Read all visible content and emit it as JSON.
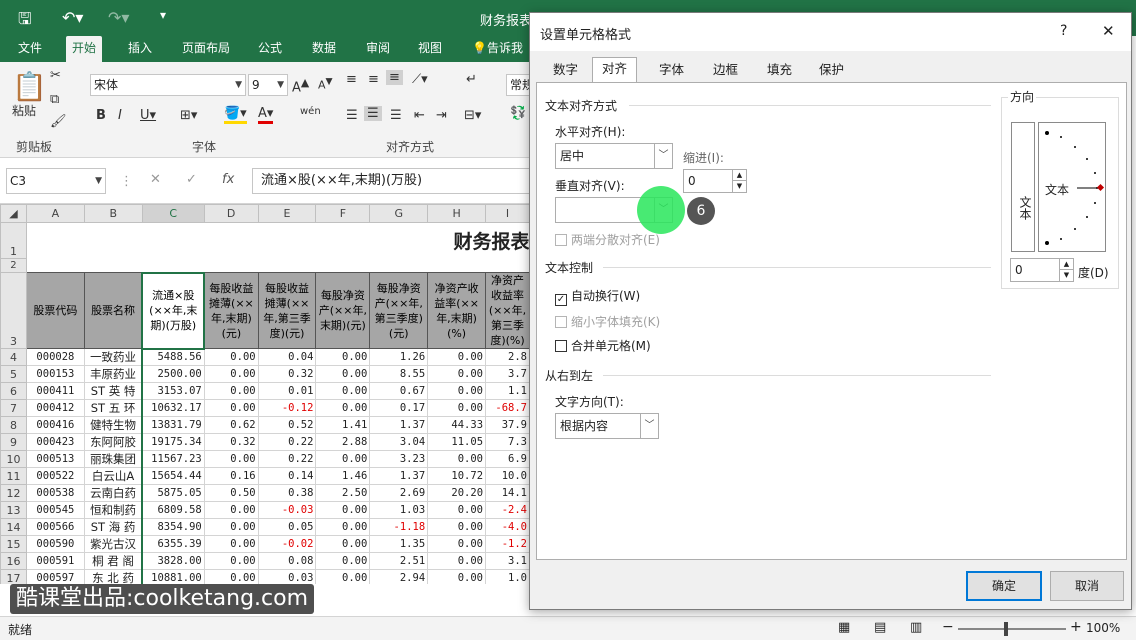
{
  "titlebar": {
    "title": "财务报表"
  },
  "ribbon": {
    "tabs": [
      "文件",
      "开始",
      "插入",
      "页面布局",
      "公式",
      "数据",
      "审阅",
      "视图",
      "告诉我你"
    ],
    "active_tab": "开始",
    "paste_label": "粘贴",
    "clipboard_label": "剪贴板",
    "font_group_label": "字体",
    "align_group_label": "对齐方式",
    "font_name": "宋体",
    "font_size": "9",
    "number_format": "常规",
    "wrap_label": "wén"
  },
  "formula": {
    "name_box": "C3",
    "fx": "fx",
    "content": "流通×股(××年,末期)(万股)"
  },
  "sheet": {
    "title": "财务报表",
    "columns": [
      "A",
      "B",
      "C",
      "D",
      "E",
      "F",
      "G",
      "H",
      "I"
    ],
    "headers": [
      "股票代码",
      "股票名称",
      "流通×股(××年,末期)(万股)",
      "每股收益摊薄(××年,末期)(元)",
      "每股收益摊薄(××年,第三季度)(元)",
      "每股净资产(××年,末期)(元)",
      "每股净资产(××年,第三季度)(元)",
      "净资产收益率(××年,末期)(%)",
      "净资产收益率(××年,第三季度)(%)"
    ],
    "rows": [
      {
        "r": "4",
        "code": "000028",
        "name": "一致药业",
        "c": "5488.56",
        "d": "0.00",
        "e": "0.04",
        "f": "0.00",
        "g": "1.26",
        "h": "0.00",
        "i": "2.8"
      },
      {
        "r": "5",
        "code": "000153",
        "name": "丰原药业",
        "c": "2500.00",
        "d": "0.00",
        "e": "0.32",
        "f": "0.00",
        "g": "8.55",
        "h": "0.00",
        "i": "3.7"
      },
      {
        "r": "6",
        "code": "000411",
        "name": "ST 英 特",
        "c": "3153.07",
        "d": "0.00",
        "e": "0.01",
        "f": "0.00",
        "g": "0.67",
        "h": "0.00",
        "i": "1.1"
      },
      {
        "r": "7",
        "code": "000412",
        "name": "ST 五 环",
        "c": "10632.17",
        "d": "0.00",
        "e": "-0.12",
        "f": "0.00",
        "g": "0.17",
        "h": "0.00",
        "i": "-68.7"
      },
      {
        "r": "8",
        "code": "000416",
        "name": "健特生物",
        "c": "13831.79",
        "d": "0.62",
        "e": "0.52",
        "f": "1.41",
        "g": "1.37",
        "h": "44.33",
        "i": "37.9"
      },
      {
        "r": "9",
        "code": "000423",
        "name": "东阿阿胶",
        "c": "19175.34",
        "d": "0.32",
        "e": "0.22",
        "f": "2.88",
        "g": "3.04",
        "h": "11.05",
        "i": "7.3"
      },
      {
        "r": "10",
        "code": "000513",
        "name": "丽珠集团",
        "c": "11567.23",
        "d": "0.00",
        "e": "0.22",
        "f": "0.00",
        "g": "3.23",
        "h": "0.00",
        "i": "6.9"
      },
      {
        "r": "11",
        "code": "000522",
        "name": "白云山A",
        "c": "15654.44",
        "d": "0.16",
        "e": "0.14",
        "f": "1.46",
        "g": "1.37",
        "h": "10.72",
        "i": "10.0"
      },
      {
        "r": "12",
        "code": "000538",
        "name": "云南白药",
        "c": "5875.05",
        "d": "0.50",
        "e": "0.38",
        "f": "2.50",
        "g": "2.69",
        "h": "20.20",
        "i": "14.1"
      },
      {
        "r": "13",
        "code": "000545",
        "name": "恒和制药",
        "c": "6809.58",
        "d": "0.00",
        "e": "-0.03",
        "f": "0.00",
        "g": "1.03",
        "h": "0.00",
        "i": "-2.4"
      },
      {
        "r": "14",
        "code": "000566",
        "name": "ST 海 药",
        "c": "8354.90",
        "d": "0.00",
        "e": "0.05",
        "f": "0.00",
        "g": "-1.18",
        "h": "0.00",
        "i": "-4.0"
      },
      {
        "r": "15",
        "code": "000590",
        "name": "紫光古汉",
        "c": "6355.39",
        "d": "0.00",
        "e": "-0.02",
        "f": "0.00",
        "g": "1.35",
        "h": "0.00",
        "i": "-1.2"
      },
      {
        "r": "16",
        "code": "000591",
        "name": "桐 君 阁",
        "c": "3828.00",
        "d": "0.00",
        "e": "0.08",
        "f": "0.00",
        "g": "2.51",
        "h": "0.00",
        "i": "3.1"
      },
      {
        "r": "17",
        "code": "000597",
        "name": "东 北 药",
        "c": "10881.00",
        "d": "0.00",
        "e": "0.03",
        "f": "0.00",
        "g": "2.94",
        "h": "0.00",
        "i": "1.0"
      }
    ]
  },
  "status": {
    "ready": "就绪",
    "zoom": "100%"
  },
  "watermark": "酷课堂出品:coolketang.com",
  "dialog": {
    "title": "设置单元格格式",
    "help": "?",
    "close": "✕",
    "tabs": [
      "数字",
      "对齐",
      "字体",
      "边框",
      "填充",
      "保护"
    ],
    "active_tab": "对齐",
    "text_align_section": "文本对齐方式",
    "horizontal_label": "水平对齐(H):",
    "horizontal_value": "居中",
    "indent_label": "缩进(I):",
    "indent_value": "0",
    "vertical_label": "垂直对齐(V):",
    "vertical_value": "",
    "distributed_label": "两端分散对齐(E)",
    "text_control_section": "文本控制",
    "wrap_label": "自动换行(W)",
    "shrink_label": "缩小字体填充(K)",
    "merge_label": "合并单元格(M)",
    "rtl_section": "从右到左",
    "direction_label": "文字方向(T):",
    "direction_value": "根据内容",
    "orientation_section": "方向",
    "vertical_text": "文本",
    "orientation_text": "文本",
    "degree_value": "0",
    "degree_label": "度(D)",
    "ok": "确定",
    "cancel": "取消",
    "step_badge": "6"
  }
}
